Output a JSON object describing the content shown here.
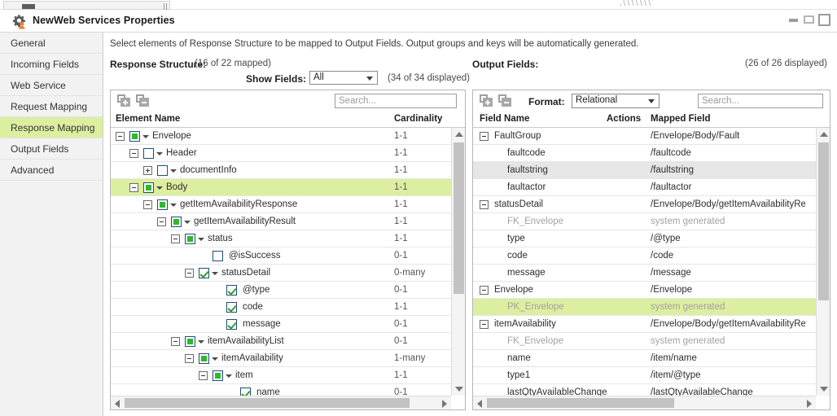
{
  "window": {
    "title": "NewWeb Services Properties",
    "app_icon": "gear-user-icon",
    "controls": {
      "minimize": "minimize-icon",
      "restore": "restore-icon",
      "maximize": "maximize-icon"
    }
  },
  "sidebar": {
    "items": [
      {
        "label": "General",
        "active": false
      },
      {
        "label": "Incoming Fields",
        "active": false
      },
      {
        "label": "Web Service",
        "active": false
      },
      {
        "label": "Request Mapping",
        "active": false
      },
      {
        "label": "Response Mapping",
        "active": true
      },
      {
        "label": "Output Fields",
        "active": false
      },
      {
        "label": "Advanced",
        "active": false
      }
    ]
  },
  "content": {
    "instruction": "Select elements of Response Structure to be mapped to Output Fields. Output groups and keys will be automatically generated.",
    "response_structure_label": "Response Structure:",
    "response_structure_count": "(16 of 22 mapped)",
    "show_fields_label": "Show Fields:",
    "show_fields_value": "All",
    "show_fields_options": [
      "All"
    ],
    "displayed_count": "(34 of 34 displayed)",
    "output_fields_label": "Output Fields:",
    "output_fields_count": "(26 of 26 displayed)"
  },
  "left_panel": {
    "toolbar": {
      "expand_all": "expand-all-icon",
      "collapse_all": "collapse-all-icon"
    },
    "search_placeholder": "Search...",
    "columns": {
      "name": "Element Name",
      "cardinality": "Cardinality"
    },
    "rows": [
      {
        "name": "Envelope",
        "cardinality": "1-1",
        "indent": 0,
        "twisty": "minus",
        "checkbox": "partial",
        "dropdown": true,
        "highlight": false
      },
      {
        "name": "Header",
        "cardinality": "1-1",
        "indent": 1,
        "twisty": "minus",
        "checkbox": "empty",
        "dropdown": true,
        "highlight": false
      },
      {
        "name": "documentInfo",
        "cardinality": "1-1",
        "indent": 2,
        "twisty": "plus",
        "checkbox": "empty",
        "dropdown": true,
        "highlight": false
      },
      {
        "name": "Body",
        "cardinality": "1-1",
        "indent": 1,
        "twisty": "minus",
        "checkbox": "partial",
        "dropdown": true,
        "highlight": true
      },
      {
        "name": "getItemAvailabilityResponse",
        "cardinality": "1-1",
        "indent": 2,
        "twisty": "minus",
        "checkbox": "partial",
        "dropdown": true,
        "highlight": false
      },
      {
        "name": "getItemAvailabilityResult",
        "cardinality": "1-1",
        "indent": 3,
        "twisty": "minus",
        "checkbox": "partial",
        "dropdown": true,
        "highlight": false
      },
      {
        "name": "status",
        "cardinality": "1-1",
        "indent": 4,
        "twisty": "minus",
        "checkbox": "partial",
        "dropdown": true,
        "highlight": false
      },
      {
        "name": "@isSuccess",
        "cardinality": "0-1",
        "indent": 6,
        "twisty": "none",
        "checkbox": "empty",
        "dropdown": false,
        "highlight": false
      },
      {
        "name": "statusDetail",
        "cardinality": "0-many",
        "indent": 5,
        "twisty": "minus",
        "checkbox": "checked",
        "dropdown": true,
        "highlight": false
      },
      {
        "name": "@type",
        "cardinality": "0-1",
        "indent": 7,
        "twisty": "none",
        "checkbox": "checked",
        "dropdown": false,
        "highlight": false
      },
      {
        "name": "code",
        "cardinality": "1-1",
        "indent": 7,
        "twisty": "none",
        "checkbox": "checked",
        "dropdown": false,
        "highlight": false
      },
      {
        "name": "message",
        "cardinality": "0-1",
        "indent": 7,
        "twisty": "none",
        "checkbox": "checked",
        "dropdown": false,
        "highlight": false
      },
      {
        "name": "itemAvailabilityList",
        "cardinality": "0-1",
        "indent": 4,
        "twisty": "minus",
        "checkbox": "partial",
        "dropdown": true,
        "highlight": false
      },
      {
        "name": "itemAvailability",
        "cardinality": "1-many",
        "indent": 5,
        "twisty": "minus",
        "checkbox": "partial",
        "dropdown": true,
        "highlight": false
      },
      {
        "name": "item",
        "cardinality": "1-1",
        "indent": 6,
        "twisty": "minus",
        "checkbox": "partial",
        "dropdown": true,
        "highlight": false
      },
      {
        "name": "name",
        "cardinality": "0-1",
        "indent": 8,
        "twisty": "none",
        "checkbox": "checked",
        "dropdown": false,
        "highlight": false
      }
    ]
  },
  "right_panel": {
    "toolbar": {
      "expand_all": "expand-all-icon",
      "collapse_all": "collapse-all-icon"
    },
    "format_label": "Format:",
    "format_value": "Relational",
    "format_options": [
      "Relational"
    ],
    "search_placeholder": "Search...",
    "columns": {
      "field_name": "Field Name",
      "actions": "Actions",
      "mapped_field": "Mapped Field"
    },
    "rows": [
      {
        "field": "FaultGroup",
        "mapped": "/Envelope/Body/Fault",
        "indent": 0,
        "twisty": "minus",
        "dim": false,
        "highlight": false,
        "hover": false
      },
      {
        "field": "faultcode",
        "mapped": "/faultcode",
        "indent": 1,
        "twisty": "none",
        "dim": false,
        "highlight": false,
        "hover": false
      },
      {
        "field": "faultstring",
        "mapped": "/faultstring",
        "indent": 1,
        "twisty": "none",
        "dim": false,
        "highlight": false,
        "hover": true
      },
      {
        "field": "faultactor",
        "mapped": "/faultactor",
        "indent": 1,
        "twisty": "none",
        "dim": false,
        "highlight": false,
        "hover": false
      },
      {
        "field": "statusDetail",
        "mapped": "/Envelope/Body/getItemAvailabilityRespons",
        "indent": 0,
        "twisty": "minus",
        "dim": false,
        "highlight": false,
        "hover": false
      },
      {
        "field": "FK_Envelope",
        "mapped": "system generated",
        "indent": 1,
        "twisty": "none",
        "dim": true,
        "highlight": false,
        "hover": false
      },
      {
        "field": "type",
        "mapped": "/@type",
        "indent": 1,
        "twisty": "none",
        "dim": false,
        "highlight": false,
        "hover": false
      },
      {
        "field": "code",
        "mapped": "/code",
        "indent": 1,
        "twisty": "none",
        "dim": false,
        "highlight": false,
        "hover": false
      },
      {
        "field": "message",
        "mapped": "/message",
        "indent": 1,
        "twisty": "none",
        "dim": false,
        "highlight": false,
        "hover": false
      },
      {
        "field": "Envelope",
        "mapped": "/Envelope",
        "indent": 0,
        "twisty": "minus",
        "dim": false,
        "highlight": false,
        "hover": false
      },
      {
        "field": "PK_Envelope",
        "mapped": "system generated",
        "indent": 1,
        "twisty": "none",
        "dim": true,
        "highlight": true,
        "hover": false
      },
      {
        "field": "itemAvailability",
        "mapped": "/Envelope/Body/getItemAvailabilityRespons",
        "indent": 0,
        "twisty": "minus",
        "dim": false,
        "highlight": false,
        "hover": false
      },
      {
        "field": "FK_Envelope",
        "mapped": "system generated",
        "indent": 1,
        "twisty": "none",
        "dim": true,
        "highlight": false,
        "hover": false
      },
      {
        "field": "name",
        "mapped": "/item/name",
        "indent": 1,
        "twisty": "none",
        "dim": false,
        "highlight": false,
        "hover": false
      },
      {
        "field": "type1",
        "mapped": "/item/@type",
        "indent": 1,
        "twisty": "none",
        "dim": false,
        "highlight": false,
        "hover": false
      },
      {
        "field": "lastQtyAvailableChange",
        "mapped": "/lastQtyAvailableChange",
        "indent": 1,
        "twisty": "none",
        "dim": false,
        "highlight": false,
        "hover": false
      }
    ]
  }
}
